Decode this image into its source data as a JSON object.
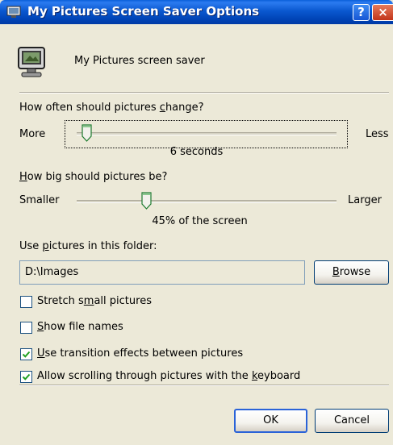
{
  "window": {
    "title": "My Pictures Screen Saver Options",
    "help_glyph": "?",
    "close_glyph": "×",
    "accent_color": "#0a58d0"
  },
  "header": {
    "label": "My Pictures screen saver",
    "icon": "monitor-icon"
  },
  "change_section": {
    "label_pre": "How often should pictures ",
    "label_ul": "c",
    "label_post": "hange?",
    "min_label": "More",
    "max_label": "Less",
    "value_text": "6 seconds",
    "slider_fraction": 0.04
  },
  "size_section": {
    "label_pre": "",
    "label_ul": "H",
    "label_post": "ow big should pictures be?",
    "min_label": "Smaller",
    "max_label": "Larger",
    "value_text": "45% of the screen",
    "slider_fraction": 0.27
  },
  "folder_section": {
    "label_pre": "Use ",
    "label_ul": "p",
    "label_post": "ictures in this folder:",
    "path_value": "D:\\Images",
    "browse_ul": "B",
    "browse_post": "rowse"
  },
  "options": [
    {
      "pre": "Stretch s",
      "ul": "m",
      "post": "all pictures",
      "checked": false
    },
    {
      "pre": "",
      "ul": "S",
      "post": "how file names",
      "checked": false
    },
    {
      "pre": "",
      "ul": "U",
      "post": "se transition effects between pictures",
      "checked": true
    },
    {
      "pre": "Allow scrolling through pictures with the ",
      "ul": "k",
      "post": "eyboard",
      "checked": true
    }
  ],
  "footer": {
    "ok_label": "OK",
    "cancel_label": "Cancel"
  }
}
